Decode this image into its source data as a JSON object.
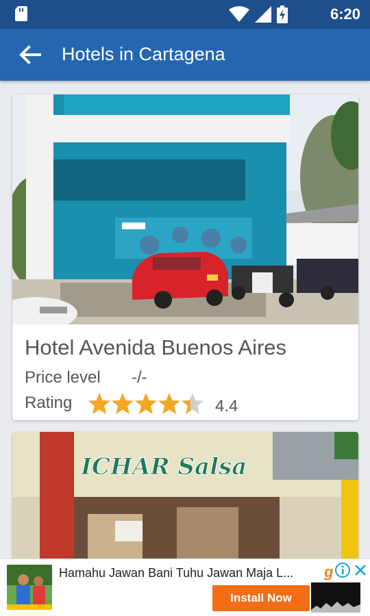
{
  "status_bar": {
    "time": "6:20",
    "icons": [
      "sd-card-icon",
      "wifi-icon",
      "signal-icon",
      "battery-charging-icon"
    ]
  },
  "app_bar": {
    "title": "Hotels in Cartagena",
    "back_icon": "arrow-back-icon"
  },
  "hotels": [
    {
      "name": "Hotel Avenida Buenos Aires",
      "price_label": "Price level",
      "price_value": "-/-",
      "rating_label": "Rating",
      "rating_value": "4.4",
      "rating_stars": 4.4
    },
    {
      "name": "",
      "sign_text": "ICHAR Salsa"
    }
  ],
  "ad": {
    "title": "Hamahu Jawan Bani Tuhu Jawan Maja L...",
    "button_label": "Install Now",
    "brand_glyph": "g"
  },
  "colors": {
    "status_bar": "#1c4f8c",
    "app_bar": "#2566b0",
    "star": "#f5a623",
    "install_button": "#f36d16"
  }
}
